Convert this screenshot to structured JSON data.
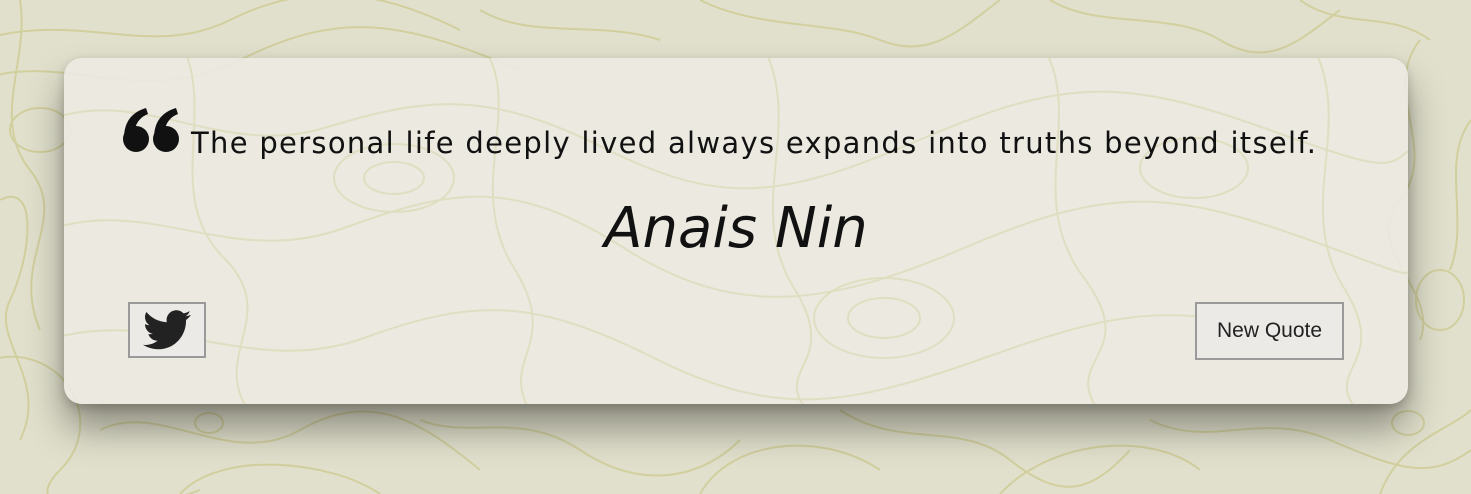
{
  "quote": {
    "text": "The personal life deeply lived always expands into truths beyond itself.",
    "author": "Anais Nin",
    "quote_icon": "quote-open-icon"
  },
  "actions": {
    "tweet_icon": "twitter-bird-icon",
    "new_quote_label": "New Quote"
  },
  "colors": {
    "background": "#e1e0cc",
    "contour_lines": "#cfcd96",
    "card": "#ecebe4",
    "text": "#111111",
    "button_border": "#9a9a9a"
  }
}
